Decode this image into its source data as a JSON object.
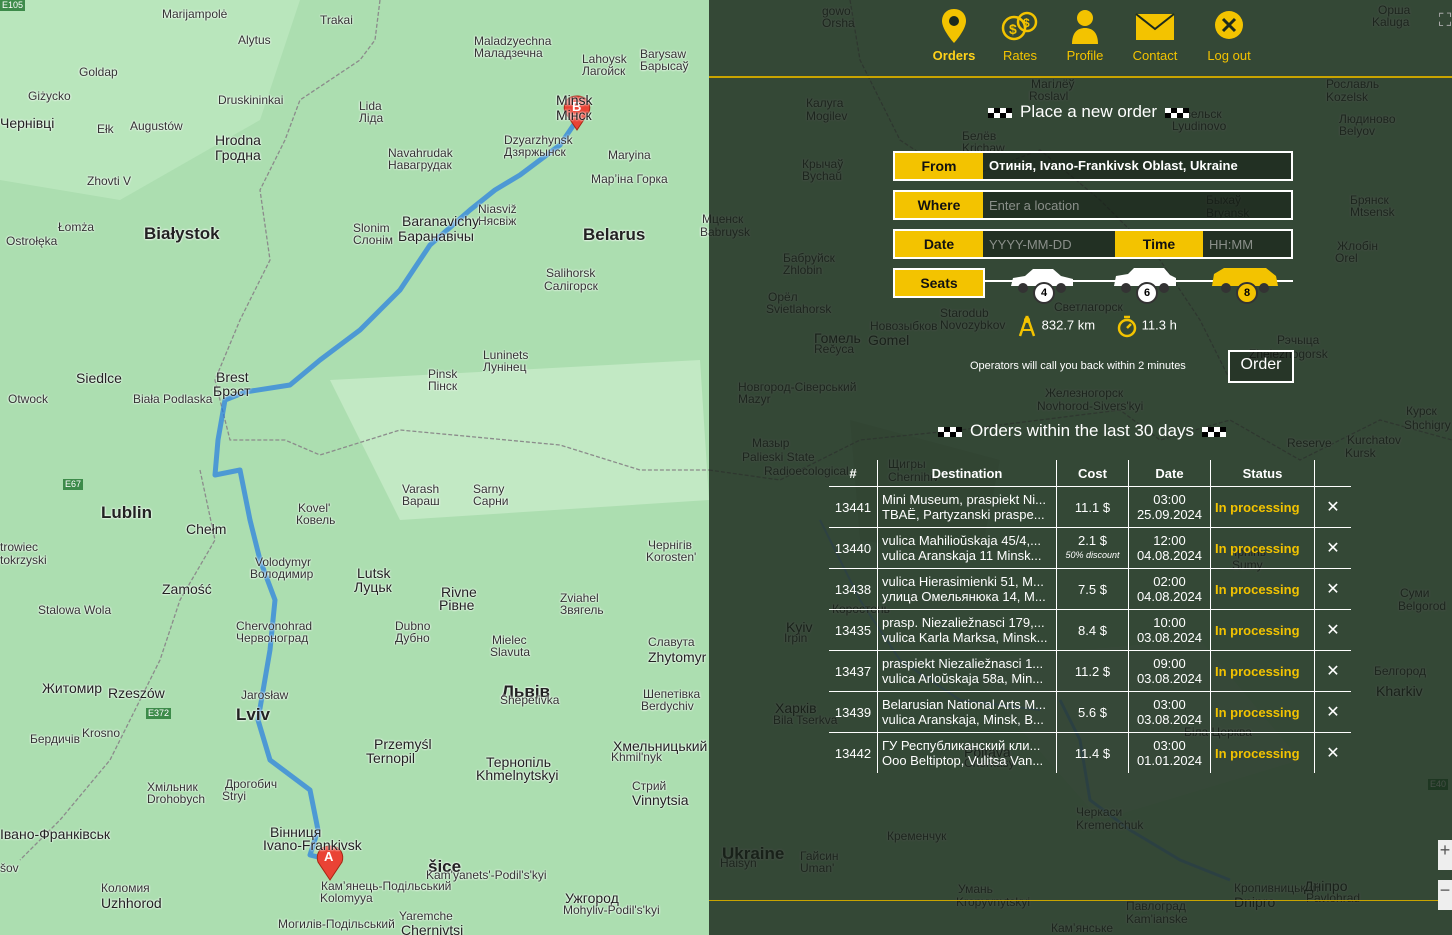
{
  "nav": {
    "orders": "Orders",
    "rates": "Rates",
    "profile": "Profile",
    "contact": "Contact",
    "logout": "Log out"
  },
  "form": {
    "title": "Place a new order",
    "from_label": "From",
    "from_value": "Отинія, Ivano-Frankivsk Oblast, Ukraine",
    "where_label": "Where",
    "where_placeholder": "Enter a location",
    "date_label": "Date",
    "date_placeholder": "YYYY-MM-DD",
    "time_label": "Time",
    "time_placeholder": "HH:MM",
    "seats_label": "Seats",
    "seat_options": [
      "4",
      "6",
      "8"
    ],
    "selected_seats": "8",
    "distance": "832.7 km",
    "duration": "11.3 h",
    "callback_note": "Operators will call you back within 2 minutes",
    "order_button": "Order"
  },
  "orders": {
    "title": "Orders within the last 30 days",
    "columns": [
      "#",
      "Destination",
      "Cost",
      "Date",
      "Status"
    ],
    "rows": [
      {
        "id": "13441",
        "dest1": "Mini Museum, praspiekt Ni...",
        "dest2": "TBAË, Partyzanski praspe...",
        "cost": "11.1 $",
        "discount": "",
        "time": "03:00",
        "date": "25.09.2024",
        "status": "In processing"
      },
      {
        "id": "13440",
        "dest1": "vulica Mahilioŭskaja 45/4,...",
        "dest2": "vulica Aranskaja 11 Minsk...",
        "cost": "2.1 $",
        "discount": "50% discount",
        "time": "12:00",
        "date": "04.08.2024",
        "status": "In processing"
      },
      {
        "id": "13438",
        "dest1": "vulica Hierasimienki 51, M...",
        "dest2": "улица Омельянюка 14, М...",
        "cost": "7.5 $",
        "discount": "",
        "time": "02:00",
        "date": "04.08.2024",
        "status": "In processing"
      },
      {
        "id": "13435",
        "dest1": "prasp. Niezaliežnasci 179,...",
        "dest2": "vulica Karla Marksa, Minsk...",
        "cost": "8.4 $",
        "discount": "",
        "time": "10:00",
        "date": "03.08.2024",
        "status": "In processing"
      },
      {
        "id": "13437",
        "dest1": "praspiekt Niezaliežnasci 1...",
        "dest2": "vulica Arloŭskaja 58a, Min...",
        "cost": "11.2 $",
        "discount": "",
        "time": "09:00",
        "date": "03.08.2024",
        "status": "In processing"
      },
      {
        "id": "13439",
        "dest1": "Belarusian National Arts M...",
        "dest2": "vulica Aranskaja, Minsk, B...",
        "cost": "5.6 $",
        "discount": "",
        "time": "03:00",
        "date": "03.08.2024",
        "status": "In processing"
      },
      {
        "id": "13442",
        "dest1": "ГУ Республиканский кли...",
        "dest2": "Ooo Beltiptop, Vulitsa Van...",
        "cost": "11.4 $",
        "discount": "",
        "time": "03:00",
        "date": "01.01.2024",
        "status": "In processing"
      }
    ],
    "delete_glyph": "✕"
  },
  "map": {
    "marker_a": "A",
    "marker_b": "B",
    "places": [
      {
        "t": "Marijampolė",
        "c": "place"
      },
      {
        "t": "Trakai",
        "c": "place"
      },
      {
        "t": "Alytus",
        "c": "place"
      },
      {
        "t": "Maladzyechna",
        "c": "place"
      },
      {
        "t": "Маладзечна",
        "c": "place"
      },
      {
        "t": "Barysaw",
        "c": "place"
      },
      {
        "t": "Барысаў",
        "c": "place"
      },
      {
        "t": "Lahoysk",
        "c": "place"
      },
      {
        "t": "Лагойск",
        "c": "place"
      },
      {
        "t": "Goldap",
        "c": "place"
      },
      {
        "t": "Giżycko",
        "c": "place"
      },
      {
        "t": "Druskininkai",
        "c": "place"
      },
      {
        "t": "Lida",
        "c": "place"
      },
      {
        "t": "Ліда",
        "c": "place"
      },
      {
        "t": "Minsk",
        "c": "place mid"
      },
      {
        "t": "Мінск",
        "c": "place mid"
      },
      {
        "t": "Ełk",
        "c": "place"
      },
      {
        "t": "Augustów",
        "c": "place"
      },
      {
        "t": "Hrodna",
        "c": "place mid"
      },
      {
        "t": "Гродна",
        "c": "place mid"
      },
      {
        "t": "Dzyarzhynsk",
        "c": "place"
      },
      {
        "t": "Дзяржынск",
        "c": "place"
      },
      {
        "t": "Maryina",
        "c": "place"
      },
      {
        "t": "Марʼіна Горка",
        "c": "place"
      },
      {
        "t": "Navahrudak",
        "c": "place"
      },
      {
        "t": "Навагрудак",
        "c": "place"
      },
      {
        "t": "Niasviž",
        "c": "place"
      },
      {
        "t": "Нясвіж",
        "c": "place"
      },
      {
        "t": "Łomża",
        "c": "place"
      },
      {
        "t": "Białystok",
        "c": "place big"
      },
      {
        "t": "Slonim",
        "c": "place"
      },
      {
        "t": "Слонім",
        "c": "place"
      },
      {
        "t": "Baranavichy",
        "c": "place mid"
      },
      {
        "t": "Баранавічы",
        "c": "place mid"
      },
      {
        "t": "Belarus",
        "c": "place big"
      },
      {
        "t": "Ostrołęka",
        "c": "place"
      },
      {
        "t": "Salihorsk",
        "c": "place"
      },
      {
        "t": "Салігорск",
        "c": "place"
      },
      {
        "t": "Luninets",
        "c": "place"
      },
      {
        "t": "Лунінец",
        "c": "place"
      },
      {
        "t": "Siedlce",
        "c": "place mid"
      },
      {
        "t": "Brest",
        "c": "place mid"
      },
      {
        "t": "Брэст",
        "c": "place mid"
      },
      {
        "t": "Pinsk",
        "c": "place"
      },
      {
        "t": "Пінск",
        "c": "place"
      },
      {
        "t": "Biała Podlaska",
        "c": "place"
      },
      {
        "t": "Otwock",
        "c": "place"
      },
      {
        "t": "Lublin",
        "c": "place big"
      },
      {
        "t": "Varash",
        "c": "place"
      },
      {
        "t": "Вараш",
        "c": "place"
      },
      {
        "t": "Sarny",
        "c": "place"
      },
      {
        "t": "Сарни",
        "c": "place"
      },
      {
        "t": "Kovel'",
        "c": "place"
      },
      {
        "t": "Ковель",
        "c": "place"
      },
      {
        "t": "Chełm",
        "c": "place mid"
      },
      {
        "t": "Volodymyr",
        "c": "place"
      },
      {
        "t": "Володимир",
        "c": "place"
      },
      {
        "t": "Lutsk",
        "c": "place mid"
      },
      {
        "t": "Луцьк",
        "c": "place mid"
      },
      {
        "t": "trowiec",
        "c": "place"
      },
      {
        "t": "tokrzyski",
        "c": "place"
      },
      {
        "t": "Zamość",
        "c": "place mid"
      },
      {
        "t": "Stalowa Wola",
        "c": "place"
      },
      {
        "t": "Rivne",
        "c": "place mid"
      },
      {
        "t": "Рівне",
        "c": "place mid"
      },
      {
        "t": "Chervonohrad",
        "c": "place"
      },
      {
        "t": "Червоноград",
        "c": "place"
      },
      {
        "t": "Dubno",
        "c": "place"
      },
      {
        "t": "Дубно",
        "c": "place"
      },
      {
        "t": "Zviahel",
        "c": "place"
      },
      {
        "t": "Звягель",
        "c": "place"
      },
      {
        "t": "Mielec",
        "c": "place"
      },
      {
        "t": "Slavuta",
        "c": "place"
      },
      {
        "t": "Славута",
        "c": "place"
      },
      {
        "t": "Zhytomyr",
        "c": "place mid"
      },
      {
        "t": "Житомир",
        "c": "place mid"
      },
      {
        "t": "Rzeszów",
        "c": "place mid"
      },
      {
        "t": "Jarosław",
        "c": "place"
      },
      {
        "t": "Lviv",
        "c": "place big"
      },
      {
        "t": "Львів",
        "c": "place big"
      },
      {
        "t": "Shepetivka",
        "c": "place"
      },
      {
        "t": "Шепетівка",
        "c": "place"
      },
      {
        "t": "Berdychiv",
        "c": "place"
      },
      {
        "t": "Бердичів",
        "c": "place"
      },
      {
        "t": "Krosno",
        "c": "place"
      },
      {
        "t": "Przemyśl",
        "c": "place mid"
      },
      {
        "t": "Ternopil",
        "c": "place mid"
      },
      {
        "t": "Тернопіль",
        "c": "place mid"
      },
      {
        "t": "Khmelnytskyi",
        "c": "place mid"
      },
      {
        "t": "Хмельницький",
        "c": "place mid"
      },
      {
        "t": "Khmil'nyk",
        "c": "place"
      },
      {
        "t": "Хмільник",
        "c": "place"
      },
      {
        "t": "Drohobych",
        "c": "place"
      },
      {
        "t": "Дрогобич",
        "c": "place"
      },
      {
        "t": "Stryi",
        "c": "place"
      },
      {
        "t": "Стрий",
        "c": "place"
      },
      {
        "t": "Vinnytsia",
        "c": "place mid"
      },
      {
        "t": "Вінниця",
        "c": "place mid"
      },
      {
        "t": "Ivano-Frankivsk",
        "c": "place mid"
      },
      {
        "t": "Івано-Франківськ",
        "c": "place mid"
      },
      {
        "t": "šov",
        "c": "place"
      },
      {
        "t": "šice",
        "c": "place big"
      },
      {
        "t": "Kam'yanets'-Podil's'kyi",
        "c": "place"
      },
      {
        "t": "Камʼянець-Подільський",
        "c": "place"
      },
      {
        "t": "Kolomyya",
        "c": "place"
      },
      {
        "t": "Коломия",
        "c": "place"
      },
      {
        "t": "Uzhhorod",
        "c": "place mid"
      },
      {
        "t": "Ужгород",
        "c": "place mid"
      },
      {
        "t": "Mohyliv-Podil's'kyi",
        "c": "place"
      },
      {
        "t": "Могилів-Подільський",
        "c": "place"
      },
      {
        "t": "Yaremche",
        "c": "place"
      },
      {
        "t": "Chernivtsi",
        "c": "place mid"
      },
      {
        "t": "Чернівці",
        "c": "place mid"
      },
      {
        "t": "gowo",
        "c": "place"
      },
      {
        "t": "Orsha",
        "c": "place"
      },
      {
        "t": "Орша",
        "c": "place"
      },
      {
        "t": "Kaluga",
        "c": "place"
      },
      {
        "t": "Калуга",
        "c": "place"
      },
      {
        "t": "Mogilev",
        "c": "place"
      },
      {
        "t": "Магілёў",
        "c": "place"
      },
      {
        "t": "Roslavl",
        "c": "place"
      },
      {
        "t": "Рославль",
        "c": "place"
      },
      {
        "t": "Kozelsk",
        "c": "place"
      },
      {
        "t": "Козельск",
        "c": "place"
      },
      {
        "t": "Lyudinovo",
        "c": "place"
      },
      {
        "t": "Людиново",
        "c": "place"
      },
      {
        "t": "Belyov",
        "c": "place"
      },
      {
        "t": "Белёв",
        "c": "place"
      },
      {
        "t": "Krichaw",
        "c": "place"
      },
      {
        "t": "Крычаў",
        "c": "place"
      },
      {
        "t": "Bychaŭ",
        "c": "place"
      },
      {
        "t": "Быхаў",
        "c": "place"
      },
      {
        "t": "Bryansk",
        "c": "place"
      },
      {
        "t": "Брянск",
        "c": "place"
      },
      {
        "t": "Mtsensk",
        "c": "place"
      },
      {
        "t": "Мценск",
        "c": "place"
      },
      {
        "t": "Babruysk",
        "c": "place"
      },
      {
        "t": "Бабруйск",
        "c": "place"
      },
      {
        "t": "Zhlobin",
        "c": "place"
      },
      {
        "t": "Жлобін",
        "c": "place"
      },
      {
        "t": "Orel",
        "c": "place"
      },
      {
        "t": "Орёл",
        "c": "place"
      },
      {
        "t": "Svietlahorsk",
        "c": "place"
      },
      {
        "t": "Светлагорск",
        "c": "place"
      },
      {
        "t": "Starodub",
        "c": "place"
      },
      {
        "t": "Novozybkov",
        "c": "place"
      },
      {
        "t": "Новозыбков",
        "c": "place"
      },
      {
        "t": "Gomel",
        "c": "place mid"
      },
      {
        "t": "Гомель",
        "c": "place mid"
      },
      {
        "t": "Rečyca",
        "c": "place"
      },
      {
        "t": "Рэчыца",
        "c": "place"
      },
      {
        "t": "Zheleznogorsk",
        "c": "place"
      },
      {
        "t": "Железногорск",
        "c": "place"
      },
      {
        "t": "Novhorod-Sivers'kyi",
        "c": "place"
      },
      {
        "t": "Новгород-Сіверський",
        "c": "place"
      },
      {
        "t": "Mazyr",
        "c": "place"
      },
      {
        "t": "Мазыр",
        "c": "place"
      },
      {
        "t": "Palieski State",
        "c": "place"
      },
      {
        "t": "Radioecological",
        "c": "place"
      },
      {
        "t": "Reserve",
        "c": "place"
      },
      {
        "t": "Kurchatov",
        "c": "place"
      },
      {
        "t": "Kursk",
        "c": "place"
      },
      {
        "t": "Курск",
        "c": "place"
      },
      {
        "t": "Shchigry",
        "c": "place"
      },
      {
        "t": "Щигры",
        "c": "place"
      },
      {
        "t": "Chernihiv",
        "c": "place"
      },
      {
        "t": "Чернігів",
        "c": "place"
      },
      {
        "t": "Korosten'",
        "c": "place"
      },
      {
        "t": "Коростень",
        "c": "place"
      },
      {
        "t": "Kyiv",
        "c": "place mid"
      },
      {
        "t": "Irpin",
        "c": "place"
      },
      {
        "t": "Ірпінь",
        "c": "place"
      },
      {
        "t": "Sumy",
        "c": "place"
      },
      {
        "t": "Суми",
        "c": "place"
      },
      {
        "t": "Belgorod",
        "c": "place"
      },
      {
        "t": "Белгород",
        "c": "place"
      },
      {
        "t": "Kharkiv",
        "c": "place mid"
      },
      {
        "t": "Харків",
        "c": "place mid"
      },
      {
        "t": "Bila Tserkva",
        "c": "place"
      },
      {
        "t": "Біла Церква",
        "c": "place"
      },
      {
        "t": "Poltava",
        "c": "place mid"
      },
      {
        "t": "Cherkasy",
        "c": "place"
      },
      {
        "t": "Черкаси",
        "c": "place"
      },
      {
        "t": "Kremenchuk",
        "c": "place"
      },
      {
        "t": "Кременчук",
        "c": "place"
      },
      {
        "t": "Ukraine",
        "c": "place big"
      },
      {
        "t": "Haisyn",
        "c": "place"
      },
      {
        "t": "Гайсин",
        "c": "place"
      },
      {
        "t": "Uman'",
        "c": "place"
      },
      {
        "t": "Умань",
        "c": "place"
      },
      {
        "t": "Kropyvnytskyi",
        "c": "place"
      },
      {
        "t": "Кропивницький",
        "c": "place"
      },
      {
        "t": "Dnipro",
        "c": "place mid"
      },
      {
        "t": "Дніпро",
        "c": "place mid"
      },
      {
        "t": "Pavlohrad",
        "c": "place"
      },
      {
        "t": "Павлоград",
        "c": "place"
      },
      {
        "t": "Kam'ianske",
        "c": "place"
      },
      {
        "t": "Камʼянське",
        "c": "place"
      },
      {
        "t": "Zhovti V",
        "c": "place"
      },
      {
        "t": "E67",
        "c": "place"
      },
      {
        "t": "E372",
        "c": "place"
      },
      {
        "t": "E40",
        "c": "place"
      },
      {
        "t": "E105",
        "c": "place"
      }
    ]
  }
}
